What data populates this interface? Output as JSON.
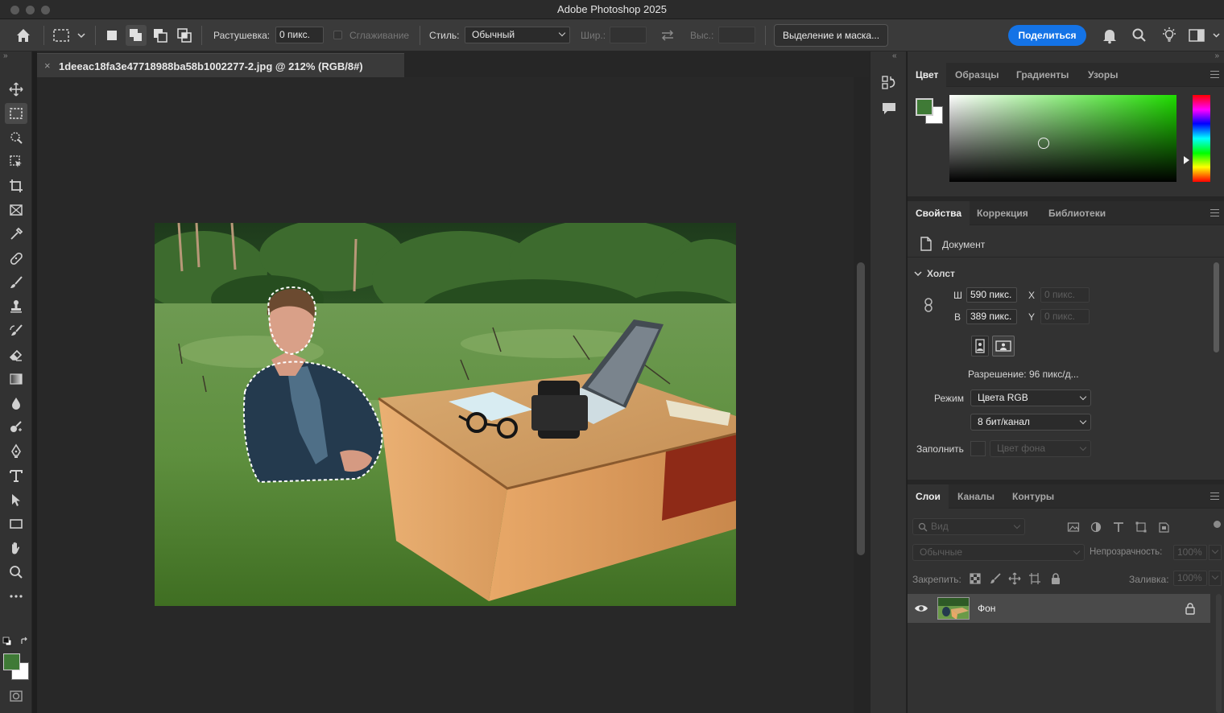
{
  "app": {
    "title": "Adobe Photoshop 2025"
  },
  "options": {
    "feather_label": "Растушевка:",
    "feather_value": "0 пикс.",
    "antialias_label": "Сглаживание",
    "style_label": "Стиль:",
    "style_value": "Обычный",
    "width_label": "Шир.:",
    "height_label": "Выс.:",
    "mask_button": "Выделение и маска...",
    "share_button": "Поделиться"
  },
  "document": {
    "tab_title": "1deeac18fa3e47718988ba58b1002277-2.jpg @ 212% (RGB/8#)",
    "close_glyph": "×"
  },
  "colors": {
    "accent": "#1473e6",
    "foreground": "#3f7a36",
    "background": "#ffffff"
  },
  "color_panel": {
    "tabs": [
      "Цвет",
      "Образцы",
      "Градиенты",
      "Узоры"
    ]
  },
  "properties_panel": {
    "tabs": [
      "Свойства",
      "Коррекция",
      "Библиотеки"
    ],
    "document_label": "Документ",
    "canvas_section": "Холст",
    "w_label": "Ш",
    "w_value": "590 пикс.",
    "h_label": "В",
    "h_value": "389 пикс.",
    "x_label": "X",
    "x_value": "0 пикс.",
    "y_label": "Y",
    "y_value": "0 пикс.",
    "resolution": "Разрешение: 96 пикс/д...",
    "mode_label": "Режим",
    "mode_value": "Цвета RGB",
    "depth_value": "8 бит/канал",
    "fill_label": "Заполнить",
    "fill_value": "Цвет фона"
  },
  "layers_panel": {
    "tabs": [
      "Слои",
      "Каналы",
      "Контуры"
    ],
    "search_placeholder": "Вид",
    "blend_mode": "Обычные",
    "opacity_label": "Непрозрачность:",
    "opacity_value": "100%",
    "lock_label": "Закрепить:",
    "fill_label": "Заливка:",
    "fill_value": "100%",
    "layer_name": "Фон"
  }
}
